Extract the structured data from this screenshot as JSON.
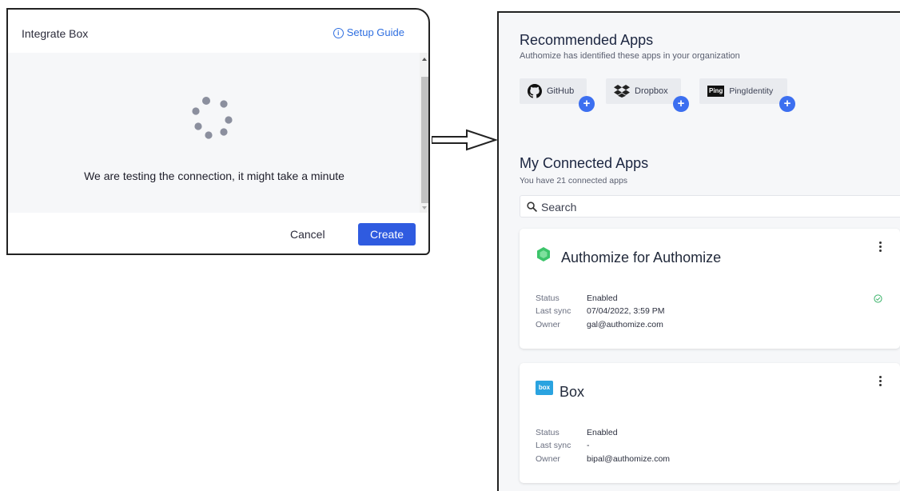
{
  "modal": {
    "title": "Integrate Box",
    "setup_guide": "Setup Guide",
    "loading_text": "We are testing the connection, it might take a minute",
    "cancel_label": "Cancel",
    "create_label": "Create"
  },
  "panel": {
    "recommended_title": "Recommended Apps",
    "recommended_subtitle": "Authomize has identified these apps in your organization",
    "recommended_apps": [
      {
        "name": "GitHub",
        "icon": "github-icon"
      },
      {
        "name": "Dropbox",
        "icon": "dropbox-icon"
      },
      {
        "name": "PingIdentity",
        "icon": "pingidentity-icon",
        "logo_text": "Ping"
      }
    ],
    "connected_title": "My Connected Apps",
    "connected_subtitle": "You have 21 connected apps",
    "search_placeholder": "Search",
    "labels": {
      "status": "Status",
      "last_sync": "Last sync",
      "owner": "Owner"
    },
    "apps": [
      {
        "name": "Authomize for Authomize",
        "icon": "authomize-icon",
        "status": "Enabled",
        "last_sync": "07/04/2022, 3:59 PM",
        "owner": "gal@authomize.com",
        "healthy": true
      },
      {
        "name": "Box",
        "icon": "box-icon",
        "logo_text": "box",
        "status": "Enabled",
        "last_sync": "-",
        "owner": "bipal@authomize.com",
        "healthy": false
      }
    ]
  },
  "colors": {
    "primary": "#2f5be0",
    "accent_badge": "#3c6ff0",
    "link": "#2f6fe0",
    "success": "#3bb36a",
    "box_brand": "#2aa3e0",
    "authomize_brand": "#3cc46a"
  }
}
